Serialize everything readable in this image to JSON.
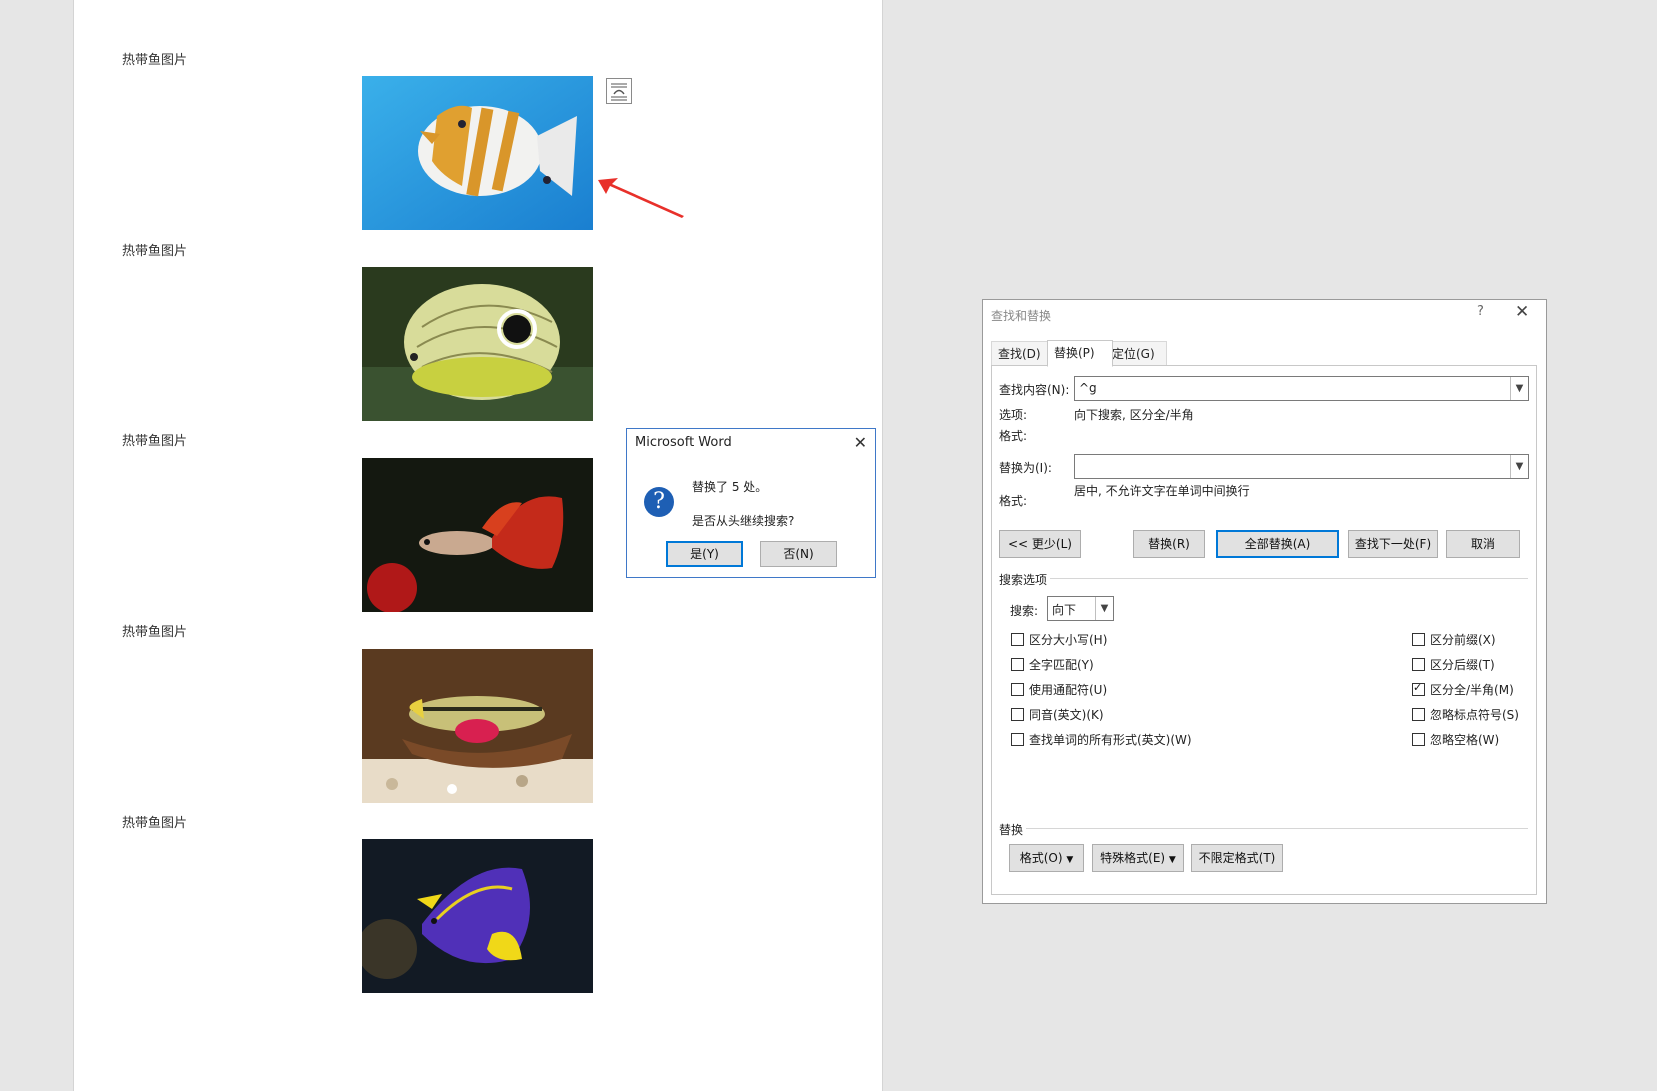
{
  "document": {
    "image_labels": [
      "热带鱼图片",
      "热带鱼图片",
      "热带鱼图片",
      "热带鱼图片",
      "热带鱼图片"
    ]
  },
  "message_box": {
    "title": "Microsoft Word",
    "line1": "替换了 5 处。",
    "line2": "是否从头继续搜索?",
    "yes_button": "是(Y)",
    "no_button": "否(N)"
  },
  "find_replace": {
    "title": "查找和替换",
    "help": "?",
    "tabs": [
      "查找(D)",
      "替换(P)",
      "定位(G)"
    ],
    "find_label": "查找内容(N):",
    "find_value": "^g",
    "options_label": "选项:",
    "options_value": "向下搜索, 区分全/半角",
    "format_label": "格式:",
    "replace_label": "替换为(I):",
    "replace_value": "",
    "replace_format_label": "格式:",
    "replace_format_value": "居中, 不允许文字在单词中间换行",
    "buttons": {
      "less": "<< 更少(L)",
      "replace": "替换(R)",
      "replace_all": "全部替换(A)",
      "find_next": "查找下一处(F)",
      "cancel": "取消"
    },
    "search_options_header": "搜索选项",
    "search_label": "搜索:",
    "search_value": "向下",
    "checkboxes_left": [
      {
        "label": "区分大小写(H)",
        "checked": false
      },
      {
        "label": "全字匹配(Y)",
        "checked": false
      },
      {
        "label": "使用通配符(U)",
        "checked": false
      },
      {
        "label": "同音(英文)(K)",
        "checked": false
      },
      {
        "label": "查找单词的所有形式(英文)(W)",
        "checked": false
      }
    ],
    "checkboxes_right": [
      {
        "label": "区分前缀(X)",
        "checked": false
      },
      {
        "label": "区分后缀(T)",
        "checked": false
      },
      {
        "label": "区分全/半角(M)",
        "checked": true
      },
      {
        "label": "忽略标点符号(S)",
        "checked": false
      },
      {
        "label": "忽略空格(W)",
        "checked": false
      }
    ],
    "replace_section_header": "替换",
    "format_button": "格式(O)",
    "special_button": "特殊格式(E)",
    "no_format_button": "不限定格式(T)"
  },
  "colors": {
    "arrow": "#e8302a",
    "accent": "#0078d7"
  }
}
